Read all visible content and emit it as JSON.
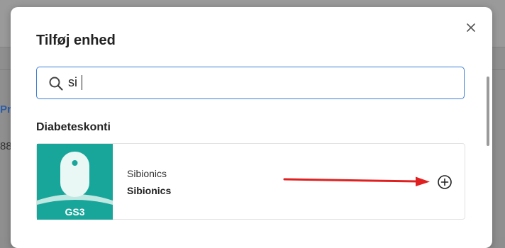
{
  "background": {
    "link_fragment": "Pr",
    "number_fragment": "88"
  },
  "dialog": {
    "title": "Tilføj enhed",
    "close_icon": "close-icon",
    "search": {
      "value": "si",
      "placeholder": "",
      "icon": "search-icon"
    },
    "section": {
      "heading": "Diabeteskonti"
    },
    "device": {
      "thumbnail_label": "GS3",
      "brand_label": "Sibionics",
      "name_label": "Sibionics",
      "add_icon": "plus-circle-icon"
    }
  },
  "colors": {
    "accent_focus": "#3f7fd6",
    "thumbnail_teal": "#19a69a",
    "annotation_arrow": "#e02020",
    "link_blue": "#2d5ea8"
  }
}
